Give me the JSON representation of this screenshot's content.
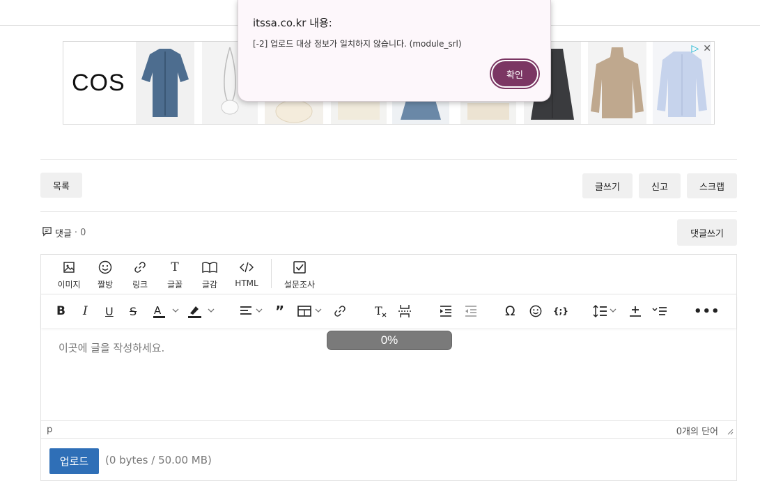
{
  "dialog": {
    "title": "itssa.co.kr 내용:",
    "message": "[-2] 업로드 대상 정보가 일치하지 않습니다. (module_srl)",
    "ok_label": "확인",
    "accent": "#7b3663"
  },
  "ad": {
    "logo": "COS",
    "tiles": [
      "denim-shirt",
      "bag",
      "knit-bag",
      "cream-jacket",
      "denim-skirt",
      "cream-cardigan",
      "black-denim-skirt",
      "beige-sweater",
      "blue-shirt"
    ]
  },
  "actions": {
    "list_label": "목록",
    "write_label": "글쓰기",
    "report_label": "신고",
    "scrap_label": "스크랩"
  },
  "comments": {
    "label": "댓글",
    "count": "· 0",
    "write_label": "댓글쓰기"
  },
  "editor": {
    "toolbar1": [
      {
        "label": "이미지",
        "icon": "image-icon"
      },
      {
        "label": "짤방",
        "icon": "smiley-icon"
      },
      {
        "label": "링크",
        "icon": "link-icon"
      },
      {
        "label": "글꼴",
        "icon": "font-icon"
      },
      {
        "label": "글감",
        "icon": "book-icon"
      },
      {
        "label": "HTML",
        "icon": "code-icon"
      },
      {
        "label": "설문조사",
        "icon": "checkbox-icon"
      }
    ],
    "progress": "0%",
    "placeholder": "이곳에 글을 작성하세요.",
    "status_path": "p",
    "word_count": "0개의 단어"
  },
  "upload": {
    "button_label": "업로드",
    "size_text": "(0 bytes / 50.00 MB)",
    "accent": "#2f6fb7"
  }
}
